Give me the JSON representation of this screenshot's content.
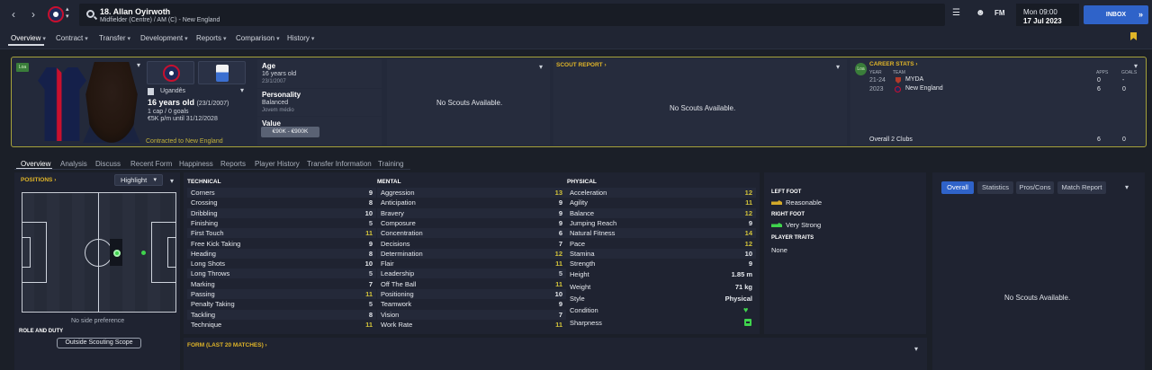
{
  "header": {
    "player_title": "18. Allan Oyirwoth",
    "player_subtitle": "Midfielder (Centre) / AM (C) - New England",
    "date_day": "Mon 09:00",
    "date_full": "17 Jul 2023",
    "inbox_label": "INBOX",
    "fm_label": "FM"
  },
  "menu": [
    "Overview",
    "Contract",
    "Transfer",
    "Development",
    "Reports",
    "Comparison",
    "History"
  ],
  "profile": {
    "loan_tag": "Loa",
    "nationality": "Ugandês",
    "age_line": "16 years old",
    "dob_inline": "(23/1/2007)",
    "caps": "1 cap / 0 goals",
    "wage": "€5K p/m until 31/12/2028",
    "contracted": "Contracted to New England"
  },
  "info": {
    "age_label": "Age",
    "age_value": "16 years old",
    "dob": "23/1/2007",
    "personality_label": "Personality",
    "personality_value": "Balanced",
    "personality_sub": "Jovem médio",
    "value_label": "Value",
    "value_range": "€90K - €900K"
  },
  "scouts": {
    "no_scouts": "No Scouts Available.",
    "report_title": "SCOUT REPORT ›"
  },
  "career": {
    "title": "CAREER STATS ›",
    "col_year": "YEAR",
    "col_team": "TEAM",
    "col_apps": "APPS",
    "col_goals": "GOALS",
    "rows": [
      {
        "year": "21-24",
        "team": "MYDA",
        "apps": "0",
        "goals": "-"
      },
      {
        "year": "2023",
        "team": "New England",
        "apps": "6",
        "goals": "0"
      }
    ],
    "overall_label": "Overall 2 Clubs",
    "overall_apps": "6",
    "overall_goals": "0"
  },
  "tabs": [
    "Overview",
    "Analysis",
    "Discuss",
    "Recent Form",
    "Happiness",
    "Reports",
    "Player History",
    "Transfer Information",
    "Training"
  ],
  "positions": {
    "title": "POSITIONS ›",
    "highlight": "Highlight",
    "no_side": "No side preference",
    "role_duty": "ROLE AND DUTY",
    "outside_scouting": "Outside Scouting Scope"
  },
  "technical": {
    "title": "TECHNICAL",
    "rows": [
      {
        "name": "Corners",
        "value": "9"
      },
      {
        "name": "Crossing",
        "value": "8"
      },
      {
        "name": "Dribbling",
        "value": "10"
      },
      {
        "name": "Finishing",
        "value": "5"
      },
      {
        "name": "First Touch",
        "value": "11"
      },
      {
        "name": "Free Kick Taking",
        "value": "9"
      },
      {
        "name": "Heading",
        "value": "8"
      },
      {
        "name": "Long Shots",
        "value": "10"
      },
      {
        "name": "Long Throws",
        "value": "5"
      },
      {
        "name": "Marking",
        "value": "7"
      },
      {
        "name": "Passing",
        "value": "11"
      },
      {
        "name": "Penalty Taking",
        "value": "5"
      },
      {
        "name": "Tackling",
        "value": "8"
      },
      {
        "name": "Technique",
        "value": "11"
      }
    ]
  },
  "mental": {
    "title": "MENTAL",
    "rows": [
      {
        "name": "Aggression",
        "value": "13"
      },
      {
        "name": "Anticipation",
        "value": "9"
      },
      {
        "name": "Bravery",
        "value": "9"
      },
      {
        "name": "Composure",
        "value": "9"
      },
      {
        "name": "Concentration",
        "value": "6"
      },
      {
        "name": "Decisions",
        "value": "7"
      },
      {
        "name": "Determination",
        "value": "12"
      },
      {
        "name": "Flair",
        "value": "11"
      },
      {
        "name": "Leadership",
        "value": "5"
      },
      {
        "name": "Off The Ball",
        "value": "11"
      },
      {
        "name": "Positioning",
        "value": "10"
      },
      {
        "name": "Teamwork",
        "value": "9"
      },
      {
        "name": "Vision",
        "value": "7"
      },
      {
        "name": "Work Rate",
        "value": "11"
      }
    ]
  },
  "physical": {
    "title": "PHYSICAL",
    "rows": [
      {
        "name": "Acceleration",
        "value": "12"
      },
      {
        "name": "Agility",
        "value": "11"
      },
      {
        "name": "Balance",
        "value": "12"
      },
      {
        "name": "Jumping Reach",
        "value": "9"
      },
      {
        "name": "Natural Fitness",
        "value": "14"
      },
      {
        "name": "Pace",
        "value": "12"
      },
      {
        "name": "Stamina",
        "value": "10"
      },
      {
        "name": "Strength",
        "value": "9"
      }
    ],
    "height_label": "Height",
    "height_value": "1.85 m",
    "weight_label": "Weight",
    "weight_value": "71 kg",
    "style_label": "Style",
    "style_value": "Physical",
    "condition_label": "Condition",
    "sharpness_label": "Sharpness"
  },
  "form": {
    "title": "FORM (LAST 20 MATCHES) ›"
  },
  "feet": {
    "left_title": "LEFT FOOT",
    "left_value": "Reasonable",
    "right_title": "RIGHT FOOT",
    "right_value": "Very Strong",
    "traits_title": "PLAYER TRAITS",
    "traits_value": "None"
  },
  "right_tabs": [
    "Overall",
    "Statistics",
    "Pros/Cons",
    "Match Report"
  ],
  "colors": {
    "accent_blue": "#2f63c9",
    "gold": "#e0b528",
    "green": "#3fd34d",
    "highlight_value": "#d2c33a"
  }
}
